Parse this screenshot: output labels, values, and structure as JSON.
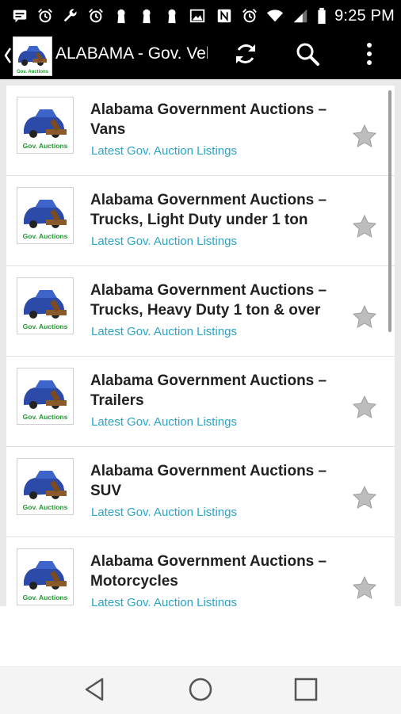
{
  "status_bar": {
    "time": "9:25 PM",
    "left_icons": [
      "message-icon",
      "alarm-icon",
      "wrench-icon",
      "alarm-icon",
      "keyhole-icon",
      "keyhole-icon",
      "keyhole-icon",
      "image-icon"
    ],
    "right_icons": [
      "nfc-icon",
      "alarm-clock-icon",
      "wifi-icon",
      "signal-icon",
      "battery-icon"
    ]
  },
  "app_bar": {
    "title": "ALABAMA - Gov. Vehicle Auctions",
    "logo_caption": "Gov. Auctions",
    "actions": [
      "refresh-icon",
      "search-icon",
      "more-vert-icon"
    ]
  },
  "listings": [
    {
      "title": "Alabama Government Auctions – Vans",
      "subtitle": "Latest Gov. Auction Listings",
      "thumb_caption": "Gov. Auctions"
    },
    {
      "title": "Alabama Government Auctions – Trucks, Light Duty under 1 ton",
      "subtitle": "Latest Gov. Auction Listings",
      "thumb_caption": "Gov. Auctions"
    },
    {
      "title": "Alabama Government Auctions – Trucks, Heavy Duty 1 ton & over",
      "subtitle": "Latest Gov. Auction Listings",
      "thumb_caption": "Gov. Auctions"
    },
    {
      "title": "Alabama Government Auctions – Trailers",
      "subtitle": "Latest Gov. Auction Listings",
      "thumb_caption": "Gov. Auctions"
    },
    {
      "title": "Alabama Government Auctions – SUV",
      "subtitle": "Latest Gov. Auction Listings",
      "thumb_caption": "Gov. Auctions"
    },
    {
      "title": "Alabama Government Auctions – Motorcycles",
      "subtitle": "Latest Gov. Auction Listings",
      "thumb_caption": "Gov. Auctions"
    }
  ],
  "nav_bar": [
    "back-triangle-icon",
    "home-circle-icon",
    "recent-apps-square-icon"
  ],
  "colors": {
    "bar": "#000000",
    "link": "#29a4c7",
    "star": "#bdbdbd",
    "caption": "#1e9b2e"
  }
}
